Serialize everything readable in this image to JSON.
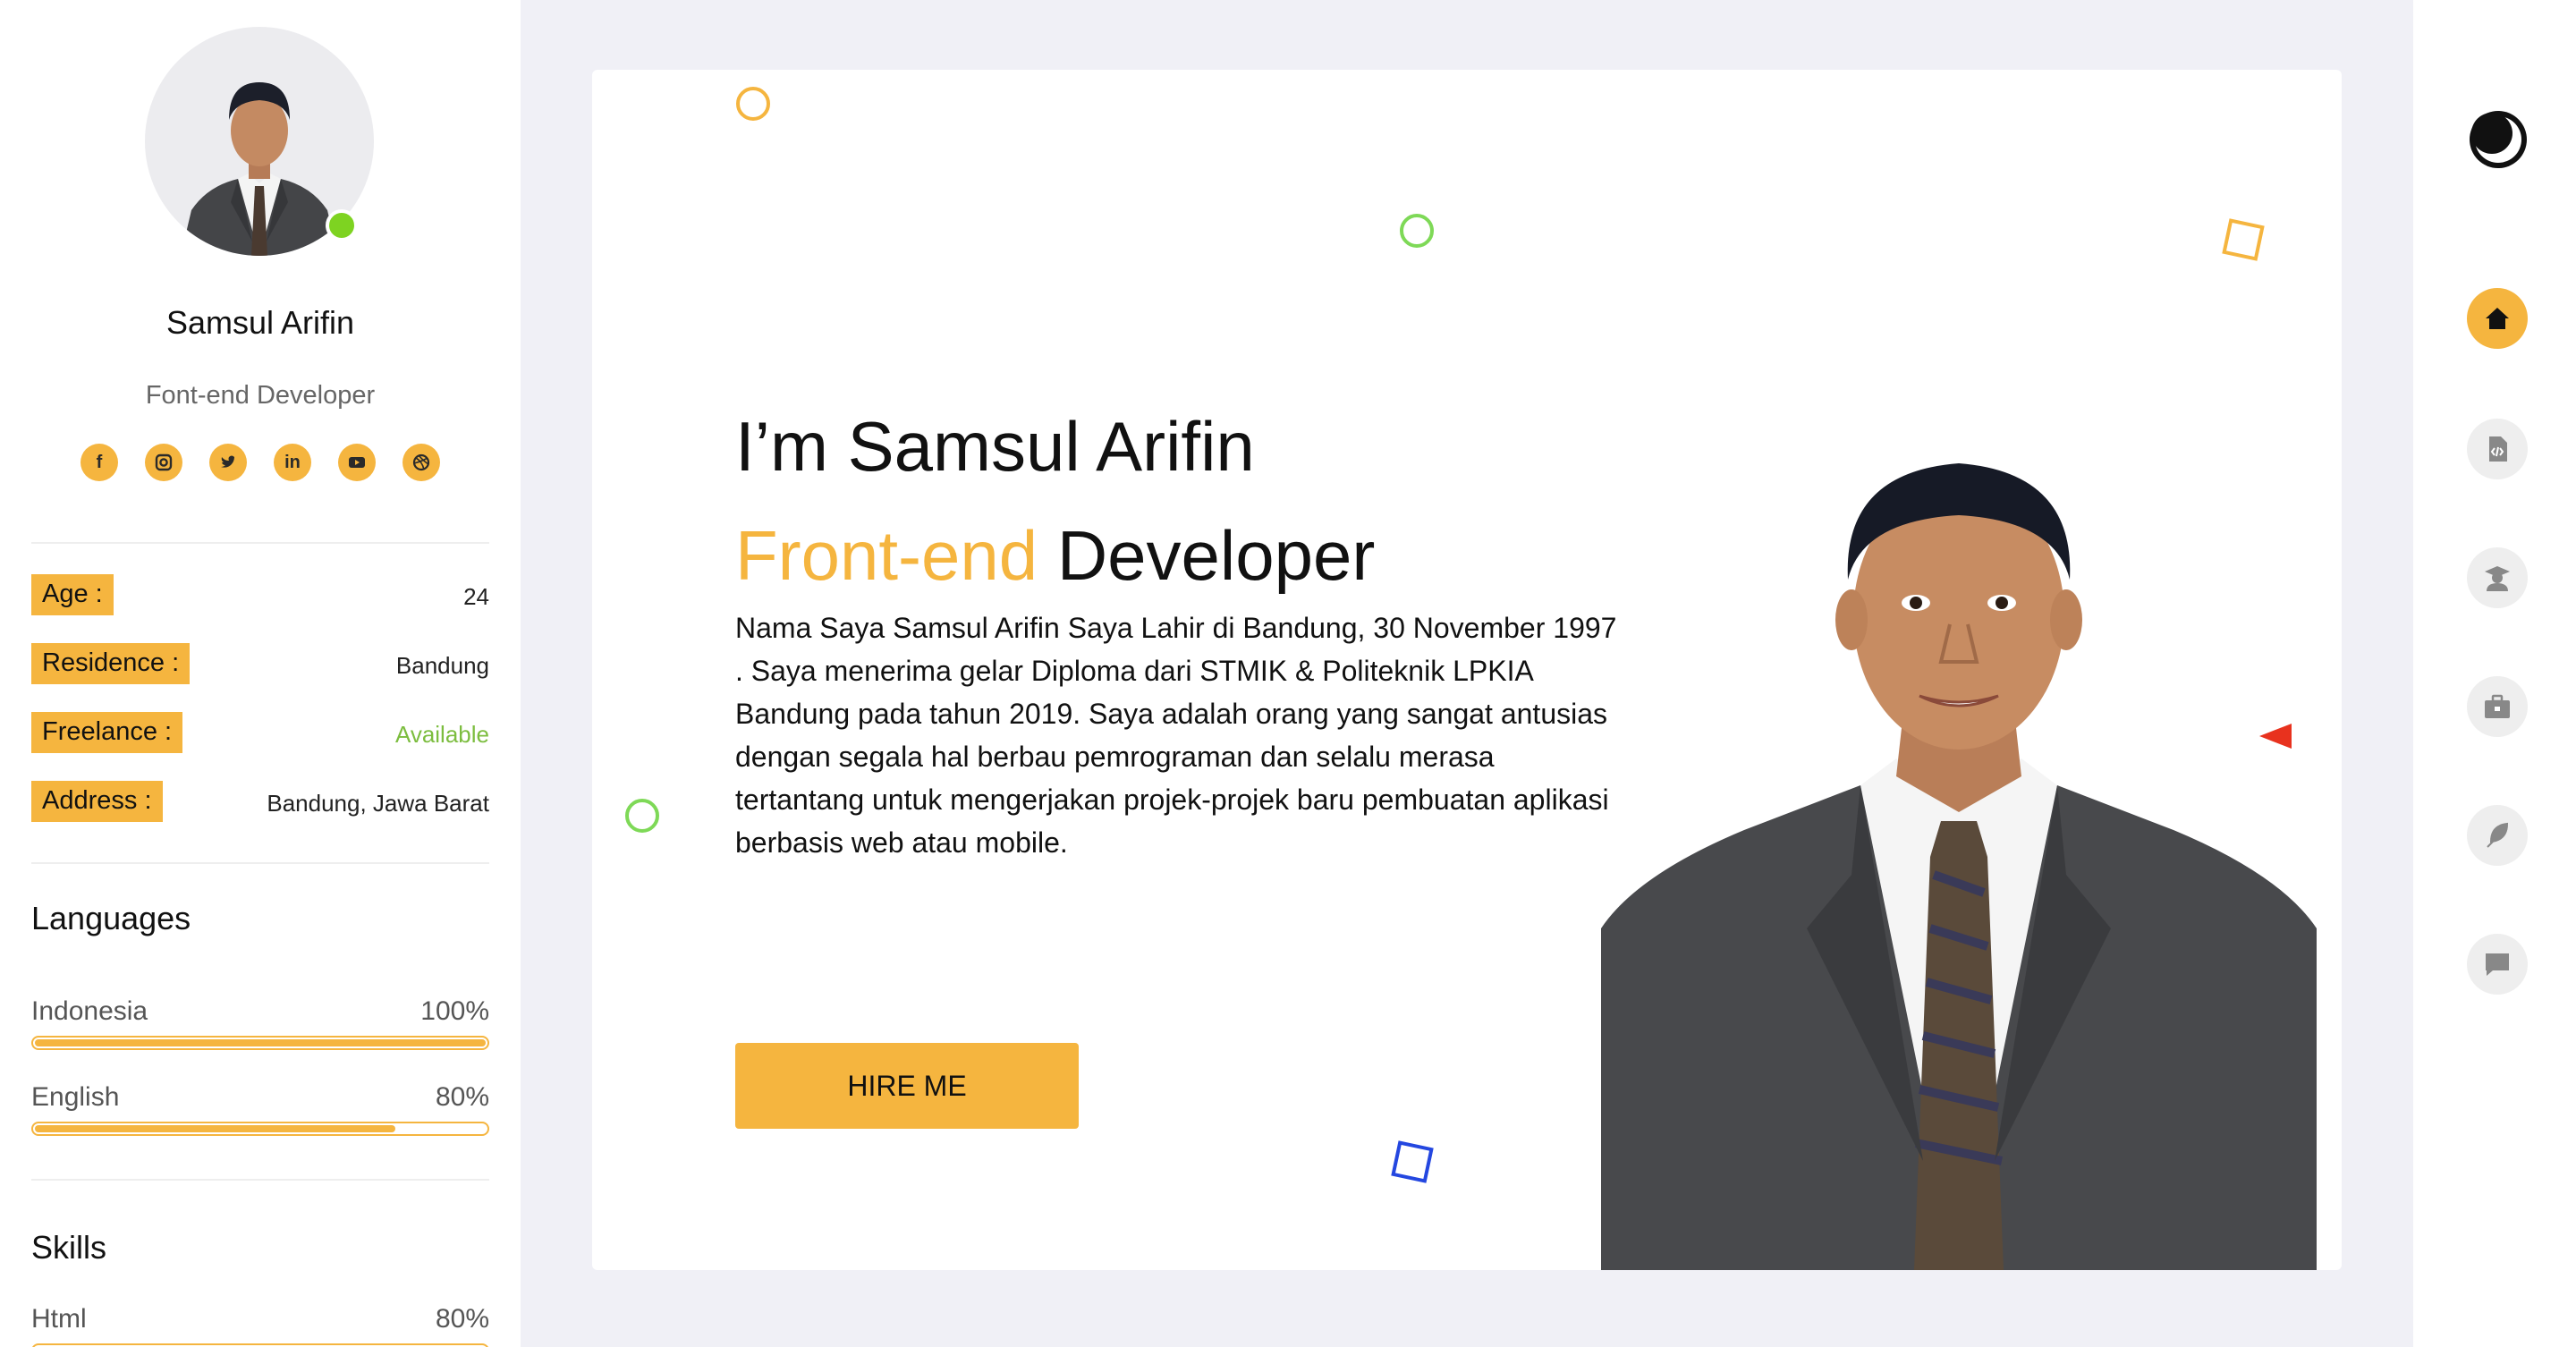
{
  "profile": {
    "name": "Samsul Arifin",
    "role": "Font-end Developer",
    "status_color": "#7ed321"
  },
  "socials": [
    {
      "icon": "facebook-icon",
      "glyph": "f"
    },
    {
      "icon": "instagram-icon",
      "glyph": ""
    },
    {
      "icon": "twitter-icon",
      "glyph": ""
    },
    {
      "icon": "linkedin-icon",
      "glyph": "in"
    },
    {
      "icon": "youtube-icon",
      "glyph": ""
    },
    {
      "icon": "dribbble-icon",
      "glyph": ""
    }
  ],
  "info": [
    {
      "label": "Age :",
      "value": "24"
    },
    {
      "label": "Residence :",
      "value": "Bandung"
    },
    {
      "label": "Freelance :",
      "value": "Available"
    },
    {
      "label": "Address :",
      "value": "Bandung, Jawa Barat"
    }
  ],
  "languages": {
    "title": "Languages",
    "items": [
      {
        "name": "Indonesia",
        "percent": "100%",
        "level": 1.0
      },
      {
        "name": "English",
        "percent": "80%",
        "level": 0.8
      }
    ]
  },
  "skills": {
    "title": "Skills",
    "items": [
      {
        "name": "Html",
        "percent": "80%",
        "level": 0.8
      }
    ]
  },
  "hero": {
    "title": "I’m Samsul Arifin",
    "subtitle_accent": "Front-end",
    "subtitle_rest": " Developer",
    "description": "Nama Saya Samsul Arifin Saya Lahir di Bandung, 30 November 1997 . Saya menerima gelar Diploma dari STMIK & Politeknik LPKIA Bandung pada tahun 2019. Saya adalah orang yang sangat antusias dengan segala hal berbau pemrograman dan selalu merasa tertantang untuk mengerjakan projek-projek baru pembuatan aplikasi berbasis web atau mobile.",
    "cta": "HIRE ME"
  },
  "nav": {
    "theme_icon": "moon-icon",
    "items": [
      {
        "icon": "home-icon",
        "active": true
      },
      {
        "icon": "code-file-icon",
        "active": false
      },
      {
        "icon": "graduate-icon",
        "active": false
      },
      {
        "icon": "briefcase-icon",
        "active": false
      },
      {
        "icon": "feather-icon",
        "active": false
      },
      {
        "icon": "chat-icon",
        "active": false
      }
    ]
  },
  "colors": {
    "accent": "#f5b53f",
    "available": "#7cbd3f",
    "background": "#f0f0f6"
  }
}
